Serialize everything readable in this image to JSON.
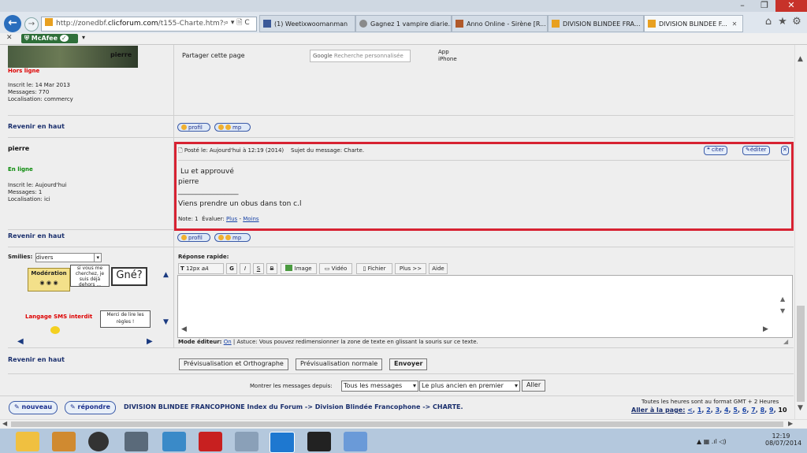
{
  "window": {
    "minimize": "–",
    "restore": "❐",
    "close": "✕"
  },
  "browser": {
    "url_prefix": "http://zonedbf.",
    "url_domain": "clicforum.com",
    "url_rest": "/t155-Charte.htm?sta",
    "url_controls": "⌕ ▾ 🗎 C",
    "tabs": [
      {
        "label": "(1) Weetixwoomanman",
        "icon_color": "#3b5998"
      },
      {
        "label": "Gagnez 1 vampire diarie...",
        "icon_color": "#8a8a8a"
      },
      {
        "label": "Anno Online - Sirène [R...",
        "icon_color": "#b0592a"
      },
      {
        "label": "DIVISION BLINDEE FRA...",
        "icon_color": "#e8a020"
      },
      {
        "label": "DIVISION BLINDEE F...",
        "icon_color": "#e8a020",
        "close": "✕"
      }
    ],
    "home_icon": "⌂",
    "star_icon": "★",
    "gear_icon": "⚙"
  },
  "mcafee": {
    "label": "McAfee",
    "close": "✕"
  },
  "forum": {
    "prev_user": {
      "name": "pierre",
      "status": "Hors ligne",
      "joined": "Inscrit le: 14 Mar 2013",
      "messages": "Messages: 770",
      "location": "Localisation: commercy"
    },
    "share_label": "Partager cette page",
    "google_placeholder": "Recherche personnalisée",
    "google_brand": "Google",
    "app_line1": "App",
    "app_line2": "iPhone",
    "back_top": "Revenir en haut",
    "profil": "profil",
    "mp": "mp",
    "post": {
      "user": "pierre",
      "status": "En ligne",
      "joined": "Inscrit le: Aujourd'hui",
      "messages": "Messages: 1",
      "location": "Localisation: ici",
      "posted": "Posté le: Aujourd'hui à 12:19 (2014)",
      "subject": "Sujet du message: Charte.",
      "citer": "citer",
      "editer": "éditer",
      "delete": "✕",
      "body_line1": "Lu et approuvé",
      "body_line2": "pierre",
      "separator": "_________________",
      "signature": "Viens prendre un obus dans ton c.l",
      "note": "Note: 1",
      "evaluer": "Évaluer:",
      "plus": "Plus",
      "dash": "-",
      "moins": "Moins"
    },
    "smilies_label": "Smilies:",
    "smilies_select": "divers",
    "smileys": {
      "moderation": "Modération",
      "sign1": "si vous me cherchez, je suis déjà dehors ...",
      "gne": "Gné?",
      "sms": "Langage SMS interdit",
      "merci": "Merci de lire les règles !"
    },
    "quick_reply": "Réponse rapide:",
    "toolbar": {
      "font": "12px",
      "aa": "aA",
      "bold": "G",
      "italic": "I",
      "underline": "S",
      "strike": "B",
      "image": "Image",
      "video": "Vidéo",
      "file": "Fichier",
      "plus": "Plus >>",
      "help": "Aide"
    },
    "editor_mode_label": "Mode éditeur:",
    "editor_mode_on": "On",
    "editor_tip": "| Astuce: Vous pouvez redimensionner la zone de texte en glissant la souris sur ce texte.",
    "buttons": {
      "preview_spell": "Prévisualisation et Orthographe",
      "preview_normal": "Prévisualisation normale",
      "send": "Envoyer"
    },
    "show_since_label": "Montrer les messages depuis:",
    "show_since_value": "Tous les messages",
    "order_value": "Le plus ancien en premier",
    "go": "Aller",
    "new_topic": "nouveau",
    "reply": "répondre",
    "breadcrumb": "DIVISION BLINDEE FRANCOPHONE Index du Forum -> Division Blindée Francophone -> CHARTE.",
    "timezone": "Toutes les heures sont au format GMT + 2 Heures",
    "goto_label": "Aller à la page:",
    "pages_prev": "<",
    "pages": [
      "1",
      "2",
      "3",
      "4",
      "5",
      "6",
      "7",
      "8",
      "9"
    ],
    "page_current": "10"
  },
  "taskbar": {
    "time": "12:19",
    "date": "08/07/2014",
    "tray_icons": "▲ ▦ .ıl ◁)"
  }
}
